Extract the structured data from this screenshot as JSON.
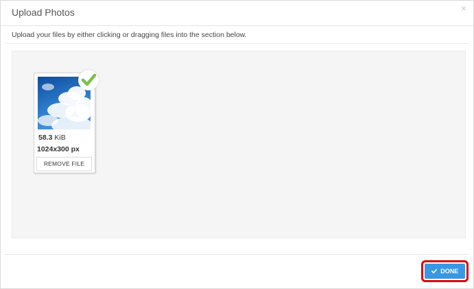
{
  "dialog": {
    "title": "Upload Photos",
    "close_glyph": "×",
    "instructions": "Upload your files by either clicking or dragging files into the section below."
  },
  "file": {
    "size_value": "58.3",
    "size_unit": "KiB",
    "dimensions": "1024x300 px",
    "remove_label": "REMOVE FILE",
    "status_icon": "check-icon",
    "status_color": "#7cc04b"
  },
  "footer": {
    "done_label": "DONE",
    "done_icon": "check-icon",
    "done_color": "#3a97e3",
    "highlight_color": "#e00000"
  }
}
